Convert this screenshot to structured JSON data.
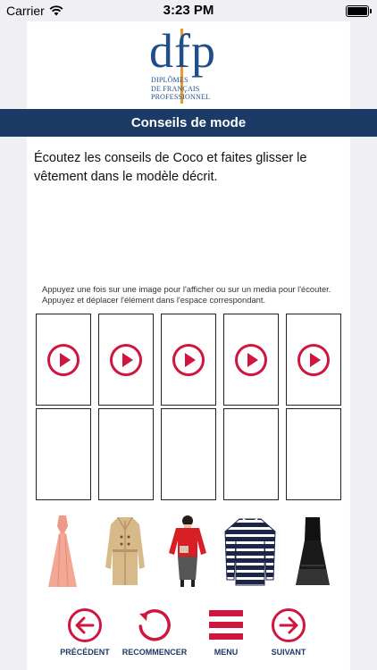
{
  "status": {
    "carrier": "Carrier",
    "time": "3:23 PM"
  },
  "logo": {
    "letters": "dfp",
    "line1": "DIPLÔMES",
    "line2": "DE FRANÇAIS",
    "line3": "PROFESSIONNEL"
  },
  "header": {
    "title": "Conseils de mode"
  },
  "exercise": {
    "instructions": "Écoutez les conseils de Coco et faites glisser le vêtement dans le modèle décrit.",
    "hint": "Appuyez une fois sur une image pour l'afficher ou sur un media pour l'écouter. Appuyez et déplacer l'élément dans l'espace correspondant."
  },
  "audio_slots": [
    "play-icon",
    "play-icon",
    "play-icon",
    "play-icon",
    "play-icon"
  ],
  "drop_zones": 5,
  "garments": [
    "pink-maxi-dress",
    "beige-trench-coat",
    "red-sweater-outfit",
    "navy-striped-sweater",
    "black-lace-dress"
  ],
  "nav": {
    "previous": "PRÉCÉDENT",
    "restart": "RECOMMENCER",
    "menu": "MENU",
    "next": "SUIVANT"
  },
  "colors": {
    "accent": "#d0163f",
    "header": "#1c3a66",
    "logo_blue": "#1f4e8c",
    "logo_orange": "#e89a2a"
  }
}
